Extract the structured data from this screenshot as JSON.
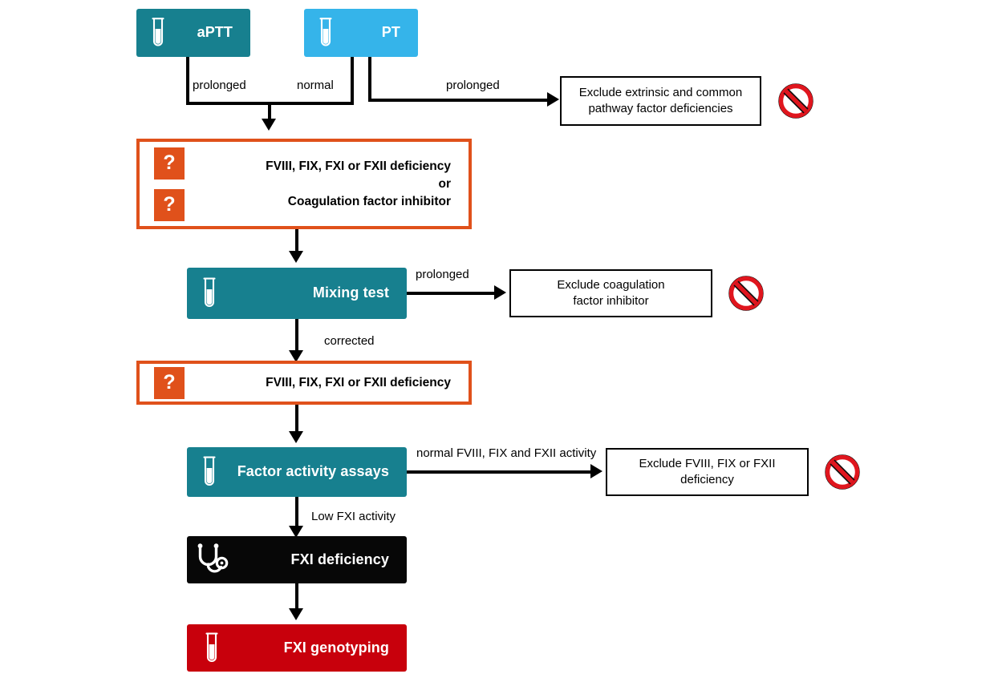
{
  "diagram": {
    "title": "aPTT / PT coagulation diagnostic algorithm",
    "colors": {
      "teal": "#17808f",
      "light_blue": "#35b4ea",
      "orange": "#e0511b",
      "black": "#070707",
      "red": "#c8000c",
      "noentry_red": "#e0161e",
      "white": "#ffffff"
    }
  },
  "nodes": {
    "aptt": {
      "label": "aPTT",
      "icon": "test-tube-icon"
    },
    "pt": {
      "label": "PT",
      "icon": "test-tube-icon"
    },
    "exclude_extrinsic": {
      "line1": "Exclude extrinsic and common",
      "line2": "pathway factor deficiencies"
    },
    "deficiency_or_inhibitor": {
      "line1": "FVIII, FIX, FXI or FXII deficiency",
      "line2": "or",
      "line3": "Coagulation factor inhibitor",
      "qmark": "?"
    },
    "mixing_test": {
      "label": "Mixing test",
      "icon": "test-tube-icon"
    },
    "exclude_inhibitor": {
      "line1": "Exclude coagulation",
      "line2": "factor inhibitor"
    },
    "deficiency": {
      "line1": "FVIII, FIX, FXI or FXII deficiency",
      "qmark": "?"
    },
    "factor_activity_assays": {
      "label": "Factor activity assays",
      "icon": "test-tube-icon"
    },
    "exclude_fviii": {
      "line1": "Exclude FVIII, FIX or FXII",
      "line2": "deficiency"
    },
    "fxi_deficiency": {
      "label": "FXI deficiency",
      "icon": "stethoscope-icon"
    },
    "fxi_genotyping": {
      "label": "FXI genotyping",
      "icon": "test-tube-icon"
    }
  },
  "edges": {
    "aptt_prolonged": "prolonged",
    "pt_normal": "normal",
    "pt_prolonged": "prolonged",
    "mixing_prolonged": "prolonged",
    "mixing_corrected": "corrected",
    "assay_normal": "normal FVIII, FIX and FXII activity",
    "assay_low": "Low FXI activity"
  },
  "icons": {
    "no_entry": "no-entry-icon"
  }
}
